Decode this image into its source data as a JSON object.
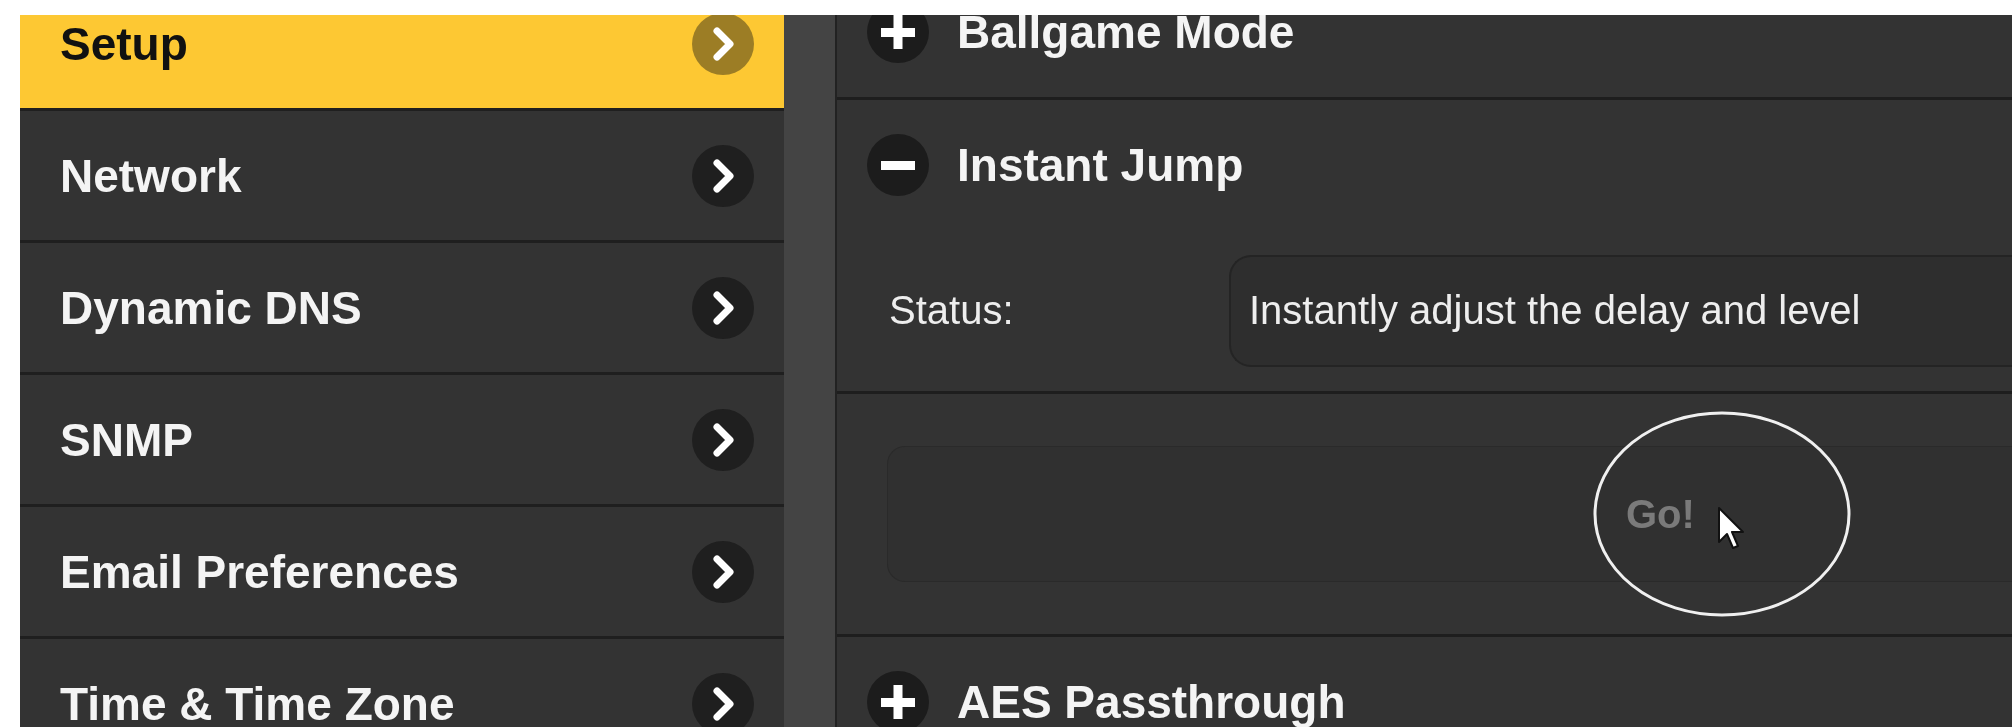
{
  "sidebar": {
    "items": [
      {
        "label": "Setup",
        "selected": true
      },
      {
        "label": "Network",
        "selected": false
      },
      {
        "label": "Dynamic DNS",
        "selected": false
      },
      {
        "label": "SNMP",
        "selected": false
      },
      {
        "label": "Email Preferences",
        "selected": false
      },
      {
        "label": "Time & Time Zone",
        "selected": false
      }
    ]
  },
  "sections": [
    {
      "title": "Ballgame Mode",
      "expanded": false
    },
    {
      "title": "Instant Jump",
      "expanded": true,
      "status_label": "Status:",
      "status_value": "Instantly adjust the delay and level",
      "go_button": {
        "label": "Go!",
        "disabled": true
      }
    },
    {
      "title": "AES Passthrough",
      "expanded": false
    }
  ]
}
